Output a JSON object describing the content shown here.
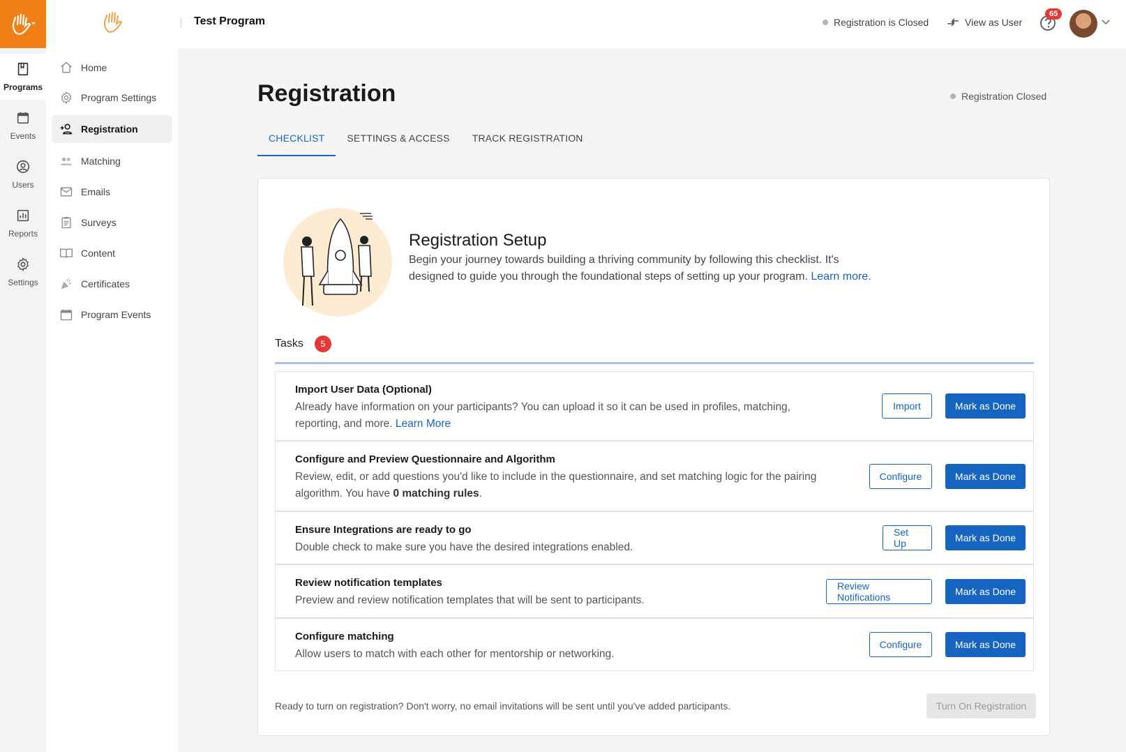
{
  "colors": {
    "brand": "#f07f16",
    "accent": "#1565c0",
    "badge": "#e53935"
  },
  "rail": [
    {
      "label": "Programs",
      "icon": "bookmark-icon",
      "active": true
    },
    {
      "label": "Events",
      "icon": "calendar-icon"
    },
    {
      "label": "Users",
      "icon": "user-circle-icon"
    },
    {
      "label": "Reports",
      "icon": "bar-chart-icon"
    },
    {
      "label": "Settings",
      "icon": "gear-icon"
    }
  ],
  "sidebar": {
    "items": [
      {
        "label": "Home",
        "icon": "home-icon"
      },
      {
        "label": "Program Settings",
        "icon": "gear-icon"
      },
      {
        "label": "Registration",
        "icon": "add-user-icon",
        "active": true
      },
      {
        "label": "Matching",
        "icon": "people-icon"
      },
      {
        "label": "Emails",
        "icon": "envelope-icon"
      },
      {
        "label": "Surveys",
        "icon": "clipboard-icon"
      },
      {
        "label": "Content",
        "icon": "book-icon"
      },
      {
        "label": "Certificates",
        "icon": "party-icon"
      },
      {
        "label": "Program Events",
        "icon": "calendar-icon"
      }
    ]
  },
  "header": {
    "program_title": "Test Program",
    "registration_status": "Registration is Closed",
    "view_as_user": "View as User",
    "help_count": "65"
  },
  "main": {
    "title": "Registration",
    "status": "Registration Closed",
    "tabs": [
      {
        "label": "CHECKLIST",
        "active": true
      },
      {
        "label": "SETTINGS & ACCESS"
      },
      {
        "label": "TRACK REGISTRATION"
      }
    ],
    "setup": {
      "title": "Registration Setup",
      "desc": "Begin your journey towards building a thriving community by following this checklist. It's designed to guide you through the foundational steps of setting up your program.",
      "learn_more": "Learn more."
    },
    "tasks_label": "Tasks",
    "tasks_count": "5",
    "tasks": [
      {
        "title": "Import User Data (Optional)",
        "desc": "Already have information on your participants? You can upload it so it can be used in profiles, matching, reporting, and more.",
        "link": "Learn More",
        "action": "Import",
        "done": "Mark as Done"
      },
      {
        "title": "Configure and Preview Questionnaire and Algorithm",
        "desc_pre": "Review, edit, or add questions you'd like to include in the questionnaire, and set matching logic for the pairing algorithm. You have",
        "desc_bold": "0 matching rules",
        "desc_post": ".",
        "action": "Configure",
        "done": "Mark as Done"
      },
      {
        "title": "Ensure Integrations are ready to go",
        "desc": "Double check to make sure you have the desired integrations enabled.",
        "action": "Set Up",
        "done": "Mark as Done"
      },
      {
        "title": "Review notification templates",
        "desc": "Preview and review notification templates that will be sent to participants.",
        "action": "Review Notifications",
        "done": "Mark as Done"
      },
      {
        "title": "Configure matching",
        "desc": "Allow users to match with each other for mentorship or networking.",
        "action": "Configure",
        "done": "Mark as Done"
      }
    ],
    "footer_note": "Ready to turn on registration? Don't worry, no email invitations will be sent until you've added participants.",
    "turn_on_label": "Turn On Registration"
  }
}
